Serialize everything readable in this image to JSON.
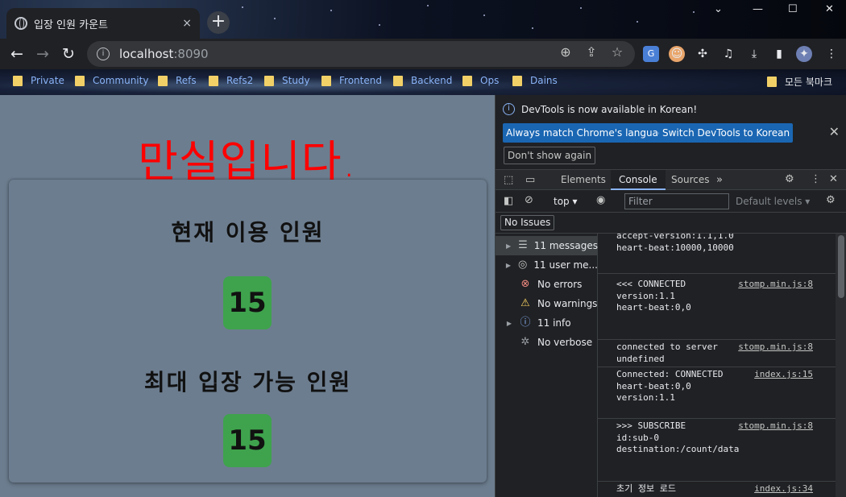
{
  "browser": {
    "tab_title": "입장 인원 카운트",
    "tab_close": "×",
    "new_tab": "+",
    "url_host": "localhost",
    "url_port": ":8090",
    "bookmarks": [
      "Private",
      "Community",
      "Refs",
      "Refs2",
      "Study",
      "Frontend",
      "Backend",
      "Ops",
      "Dains"
    ],
    "all_bookmarks": "모든 북마크"
  },
  "page": {
    "headline": "만실입니다.",
    "current_label": "현재 이용 인원",
    "current_count": "15",
    "max_label": "최대 입장 가능 인원",
    "max_count": "15"
  },
  "devtools": {
    "notice": "DevTools is now available in Korean!",
    "btn_match": "Always match Chrome's language",
    "btn_switch": "Switch DevTools to Korean",
    "btn_dont_show": "Don't show again",
    "tabs": [
      "Elements",
      "Console",
      "Sources"
    ],
    "context": "top",
    "filter_placeholder": "Filter",
    "levels": "Default levels",
    "no_issues": "No Issues",
    "sidebar": [
      {
        "label": "11 messages",
        "icon": "list-icon"
      },
      {
        "label": "11 user me...",
        "icon": "user-icon"
      },
      {
        "label": "No errors",
        "icon": "error-icon"
      },
      {
        "label": "No warnings",
        "icon": "warning-icon"
      },
      {
        "label": "11 info",
        "icon": "info-icon"
      },
      {
        "label": "No verbose",
        "icon": "bug-icon"
      }
    ],
    "messages": [
      {
        "text": "accept-version:1.1,1.0\nheart-beat:10000,10000",
        "src": ""
      },
      {
        "text": "<<< CONNECTED\nversion:1.1\nheart-beat:0,0",
        "src": "stomp.min.js:8"
      },
      {
        "text": "connected to server\nundefined",
        "src": "stomp.min.js:8"
      },
      {
        "text": "Connected: CONNECTED\nheart-beat:0,0\nversion:1.1",
        "src": "index.js:15"
      },
      {
        "text": ">>> SUBSCRIBE\nid:sub-0\ndestination:/count/data",
        "src": "stomp.min.js:8"
      },
      {
        "text": "초기 정보 로드",
        "src": "index.js:34"
      }
    ]
  }
}
